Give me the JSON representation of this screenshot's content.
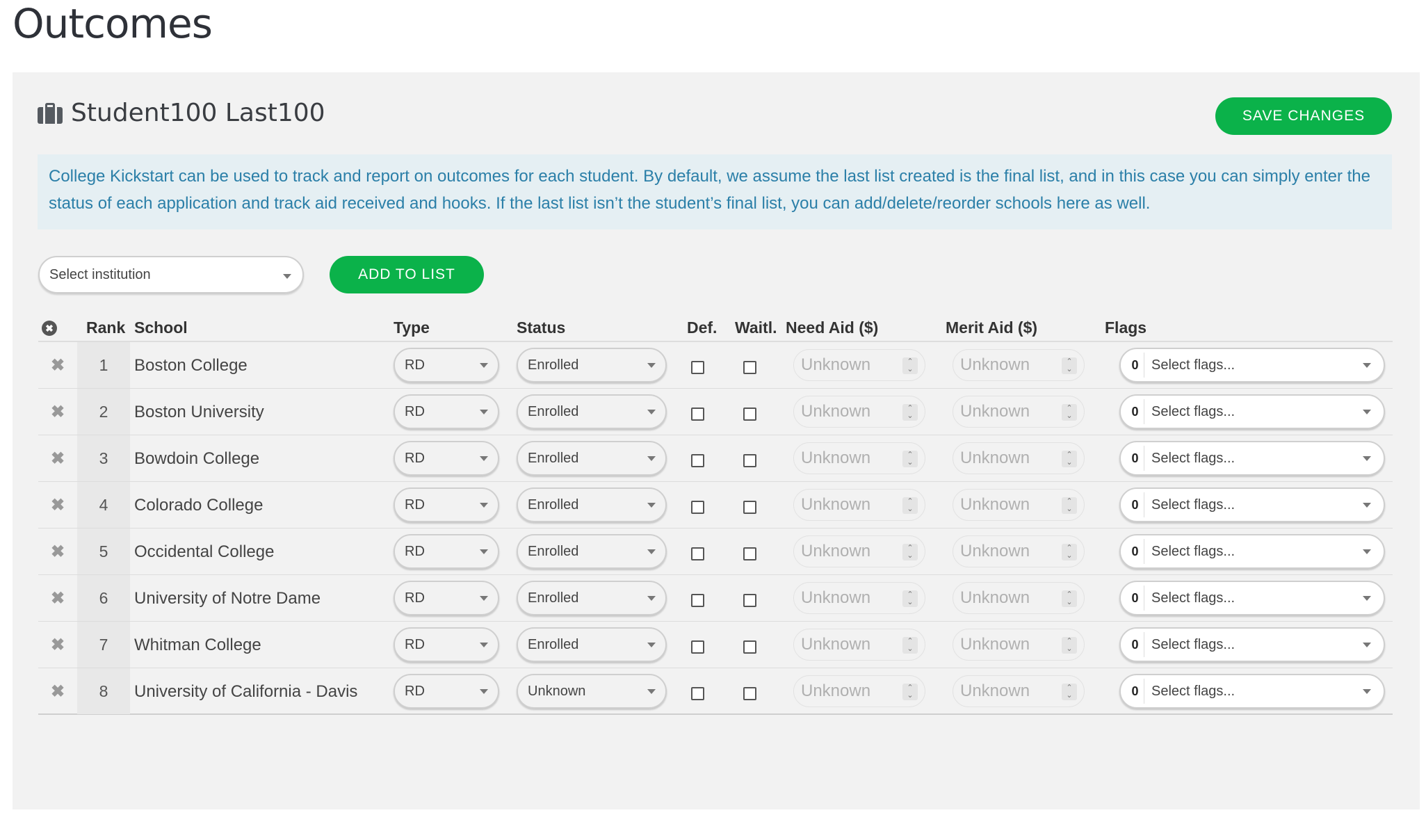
{
  "page": {
    "title": "Outcomes"
  },
  "student": {
    "name": "Student100 Last100",
    "icon": "briefcase-icon"
  },
  "toolbar": {
    "save_label": "SAVE CHANGES",
    "add_label": "ADD TO LIST"
  },
  "info": {
    "text": "College Kickstart can be used to track and report on outcomes for each student. By default, we assume the last list created is the final list, and in this case you can simply enter the status of each application and track aid received and hooks. If the last list isn’t the student’s final list, you can add/delete/reorder schools here as well."
  },
  "institution_select": {
    "placeholder": "Select institution"
  },
  "table": {
    "headers": {
      "remove": "✖",
      "rank": "Rank",
      "school": "School",
      "type": "Type",
      "status": "Status",
      "def": "Def.",
      "waitl": "Waitl.",
      "need_aid": "Need Aid ($)",
      "merit_aid": "Merit Aid ($)",
      "flags": "Flags"
    },
    "rows": [
      {
        "rank": "1",
        "school": "Boston College",
        "type": "RD",
        "status": "Enrolled",
        "need_aid": "Unknown",
        "merit_aid": "Unknown",
        "flag_count": "0",
        "flags_placeholder": "Select flags..."
      },
      {
        "rank": "2",
        "school": "Boston University",
        "type": "RD",
        "status": "Enrolled",
        "need_aid": "Unknown",
        "merit_aid": "Unknown",
        "flag_count": "0",
        "flags_placeholder": "Select flags..."
      },
      {
        "rank": "3",
        "school": "Bowdoin College",
        "type": "RD",
        "status": "Enrolled",
        "need_aid": "Unknown",
        "merit_aid": "Unknown",
        "flag_count": "0",
        "flags_placeholder": "Select flags..."
      },
      {
        "rank": "4",
        "school": "Colorado College",
        "type": "RD",
        "status": "Enrolled",
        "need_aid": "Unknown",
        "merit_aid": "Unknown",
        "flag_count": "0",
        "flags_placeholder": "Select flags..."
      },
      {
        "rank": "5",
        "school": "Occidental College",
        "type": "RD",
        "status": "Enrolled",
        "need_aid": "Unknown",
        "merit_aid": "Unknown",
        "flag_count": "0",
        "flags_placeholder": "Select flags..."
      },
      {
        "rank": "6",
        "school": "University of Notre Dame",
        "type": "RD",
        "status": "Enrolled",
        "need_aid": "Unknown",
        "merit_aid": "Unknown",
        "flag_count": "0",
        "flags_placeholder": "Select flags..."
      },
      {
        "rank": "7",
        "school": "Whitman College",
        "type": "RD",
        "status": "Enrolled",
        "need_aid": "Unknown",
        "merit_aid": "Unknown",
        "flag_count": "0",
        "flags_placeholder": "Select flags..."
      },
      {
        "rank": "8",
        "school": "University of California - Davis",
        "type": "RD",
        "status": "Unknown",
        "need_aid": "Unknown",
        "merit_aid": "Unknown",
        "flag_count": "0",
        "flags_placeholder": "Select flags..."
      }
    ]
  },
  "colors": {
    "accent": "#0bb24a",
    "info_bg": "#e5eff3",
    "info_text": "#2b7fa8"
  }
}
